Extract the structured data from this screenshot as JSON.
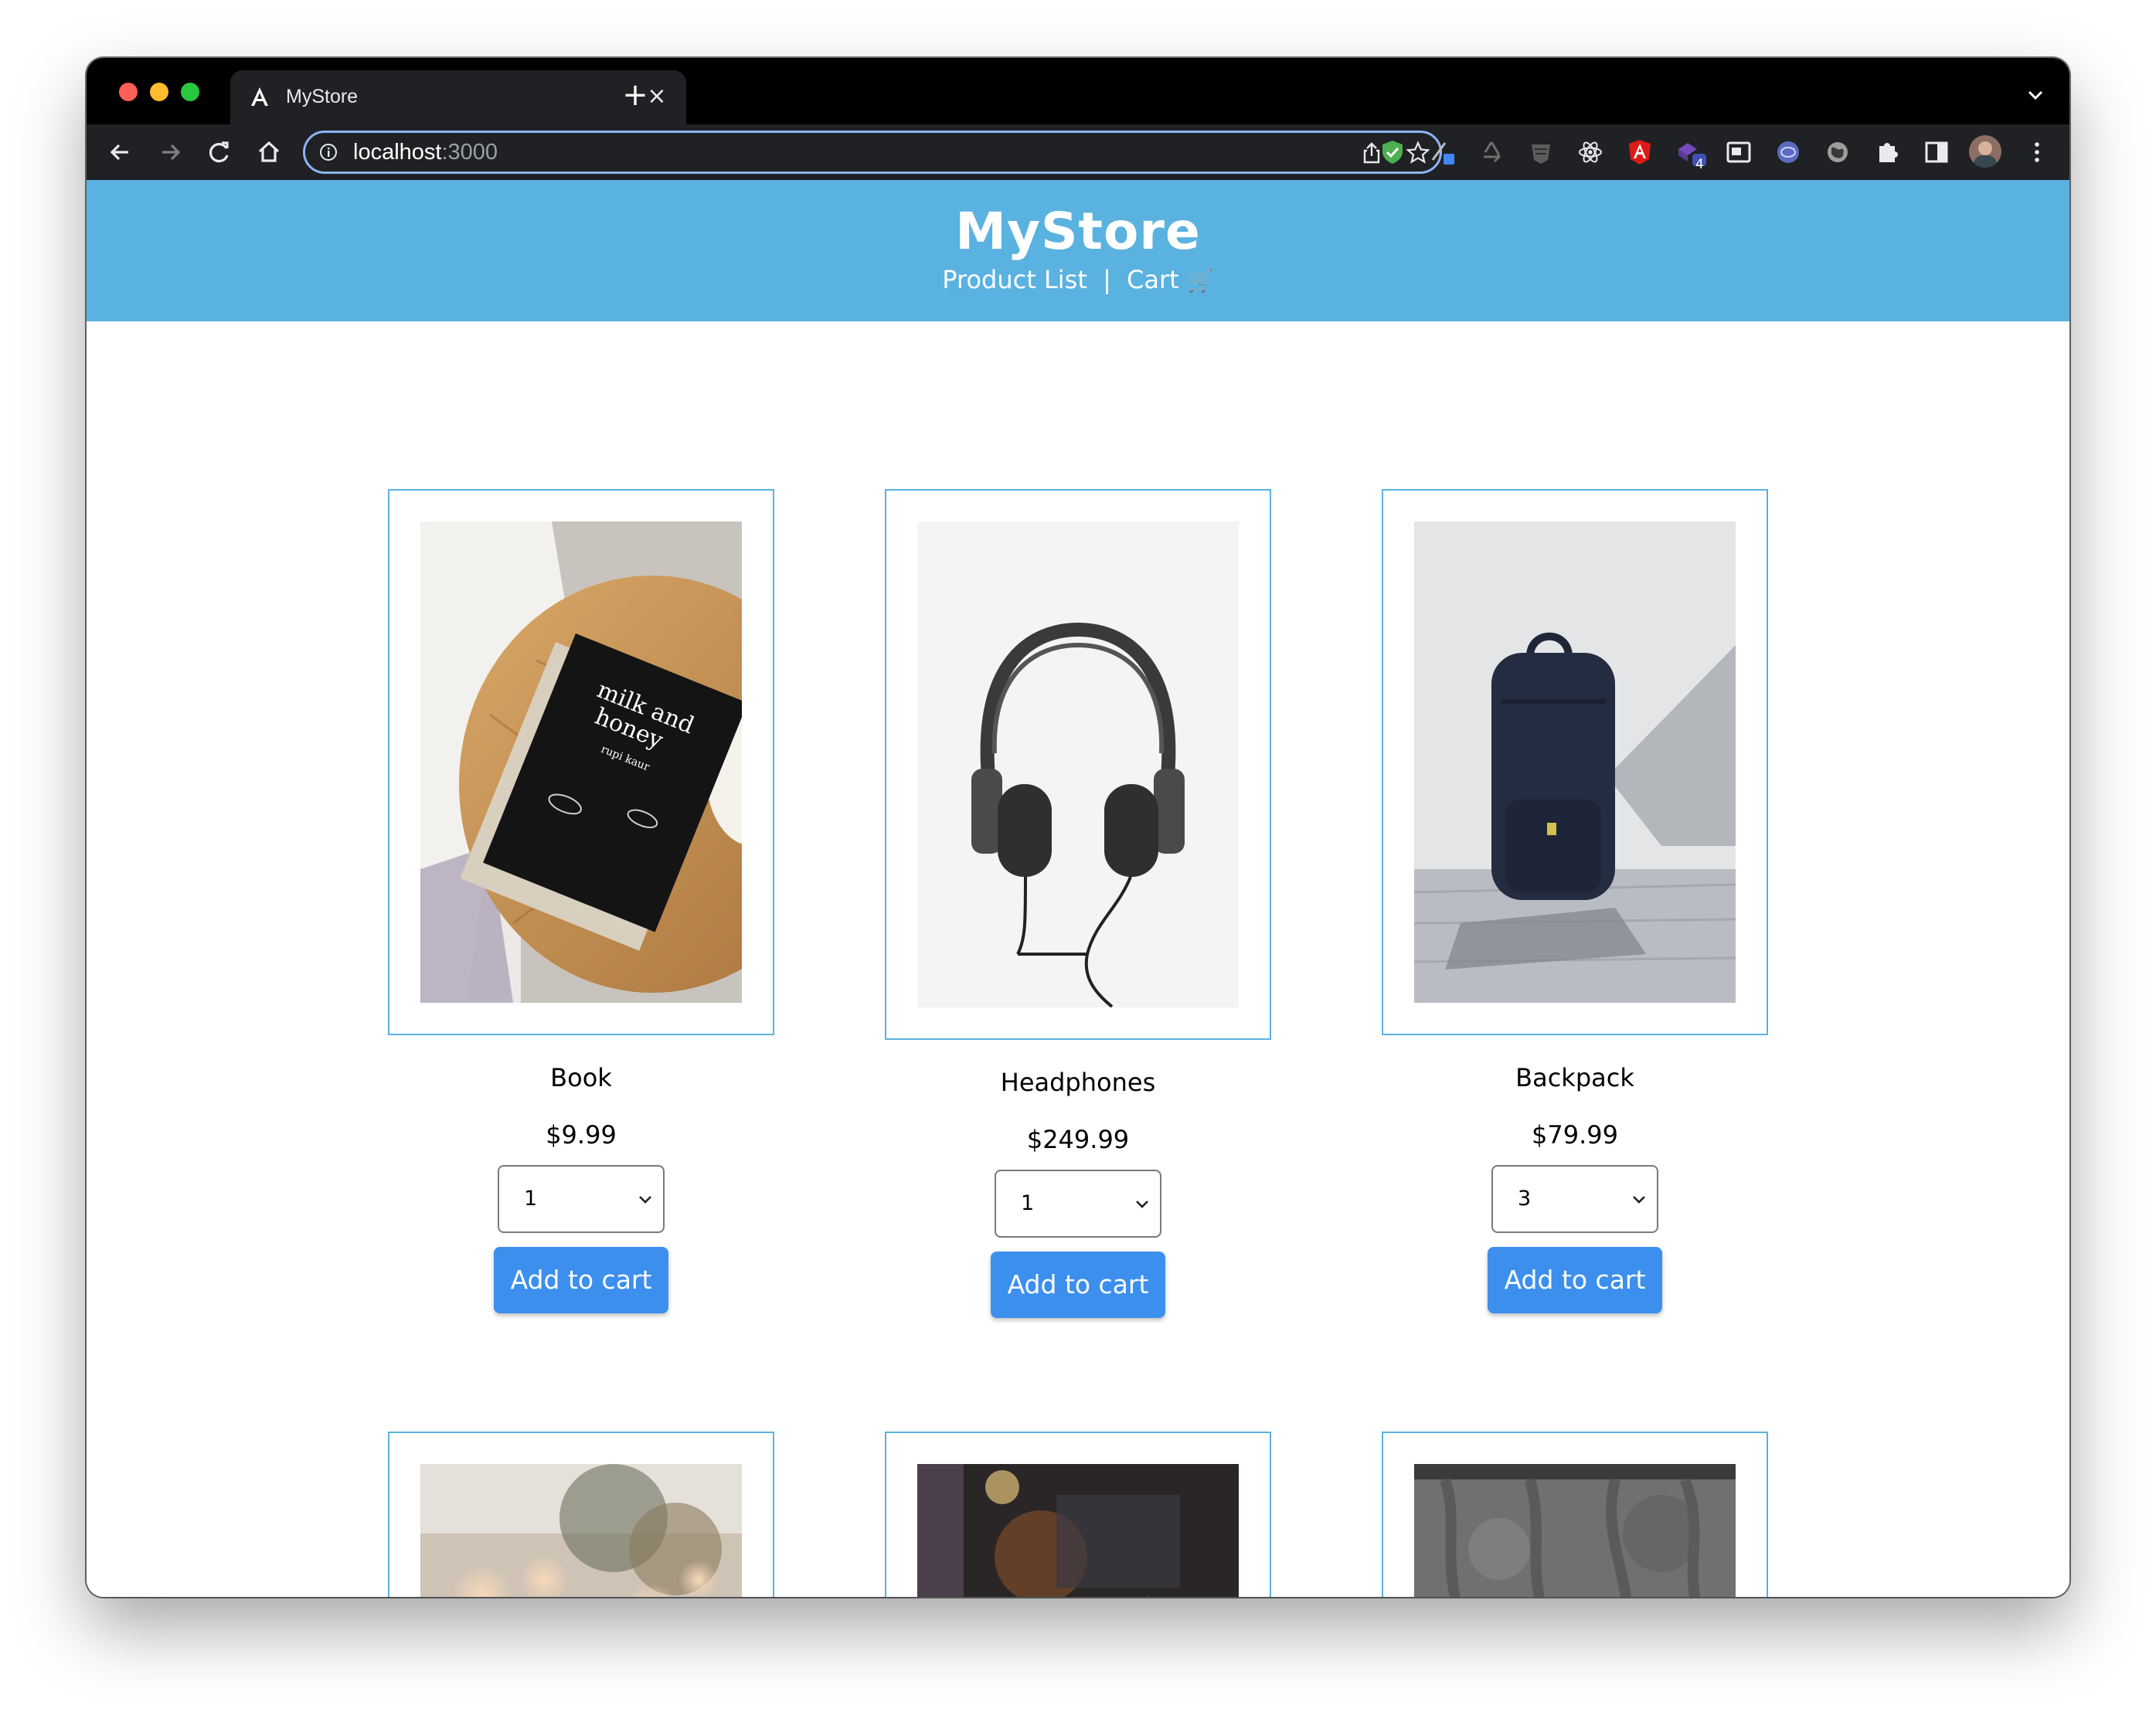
{
  "browser": {
    "tab_title": "MyStore",
    "new_tab_symbol": "+",
    "close_symbol": "×",
    "url_host": "localhost",
    "url_port": ":3000",
    "extension_badge_count": "4"
  },
  "header": {
    "brand": "MyStore",
    "nav_product_list": "Product List",
    "nav_separator": "|",
    "nav_cart": "Cart",
    "nav_cart_emoji": "🛒",
    "background_color": "#5ab2e0"
  },
  "products": [
    {
      "name": "Book",
      "price": "$9.99",
      "quantity": "1",
      "button": "Add to cart"
    },
    {
      "name": "Headphones",
      "price": "$249.99",
      "quantity": "1",
      "button": "Add to cart"
    },
    {
      "name": "Backpack",
      "price": "$79.99",
      "quantity": "3",
      "button": "Add to cart"
    }
  ],
  "colors": {
    "accent_button": "#3d8fee",
    "card_border": "#5ab2e0",
    "omnibox_focus": "#8ab4f8"
  },
  "icons": [
    "angular-icon",
    "close-icon",
    "plus-icon",
    "chevron-down-icon",
    "back-arrow-icon",
    "forward-arrow-icon",
    "reload-icon",
    "home-icon",
    "info-icon",
    "share-icon",
    "bookmark-star-icon",
    "shield-extension-icon",
    "pen-extension-icon",
    "recycle-extension-icon",
    "mask-extension-icon",
    "react-extension-icon",
    "angular-extension-icon",
    "redux-extension-icon",
    "window-extension-icon",
    "globe-extension-icon",
    "puzzle-extension-icon",
    "sidepanel-icon",
    "profile-avatar",
    "more-menu-icon"
  ]
}
